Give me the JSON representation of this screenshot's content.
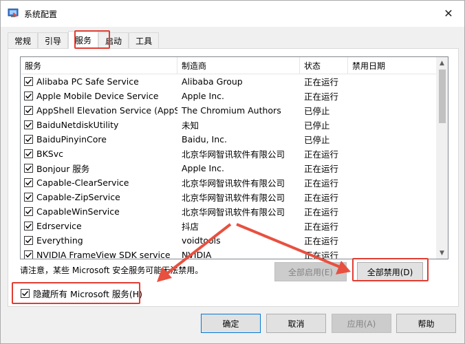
{
  "window": {
    "title": "系统配置",
    "close_glyph": "✕"
  },
  "tabs": [
    {
      "label": "常规"
    },
    {
      "label": "引导"
    },
    {
      "label": "服务"
    },
    {
      "label": "启动"
    },
    {
      "label": "工具"
    }
  ],
  "list": {
    "headers": {
      "service": "服务",
      "maker": "制造商",
      "status": "状态",
      "date": "禁用日期"
    },
    "rows": [
      {
        "service": "Alibaba PC Safe Service",
        "maker": "Alibaba Group",
        "status": "正在运行",
        "date": ""
      },
      {
        "service": "Apple Mobile Device Service",
        "maker": "Apple Inc.",
        "status": "正在运行",
        "date": ""
      },
      {
        "service": "AppShell Elevation Service (AppS...",
        "maker": "The Chromium Authors",
        "status": "已停止",
        "date": ""
      },
      {
        "service": "BaiduNetdiskUtility",
        "maker": "未知",
        "status": "已停止",
        "date": ""
      },
      {
        "service": "BaiduPinyinCore",
        "maker": "Baidu, Inc.",
        "status": "已停止",
        "date": ""
      },
      {
        "service": "BKSvc",
        "maker": "北京华网智讯软件有限公司",
        "status": "正在运行",
        "date": ""
      },
      {
        "service": "Bonjour 服务",
        "maker": "Apple Inc.",
        "status": "正在运行",
        "date": ""
      },
      {
        "service": "Capable-ClearService",
        "maker": "北京华网智讯软件有限公司",
        "status": "正在运行",
        "date": ""
      },
      {
        "service": "Capable-ZipService",
        "maker": "北京华网智讯软件有限公司",
        "status": "正在运行",
        "date": ""
      },
      {
        "service": "CapableWinService",
        "maker": "北京华网智讯软件有限公司",
        "status": "正在运行",
        "date": ""
      },
      {
        "service": "Edrservice",
        "maker": "抖店",
        "status": "正在运行",
        "date": ""
      },
      {
        "service": "Everything",
        "maker": "voidtools",
        "status": "正在运行",
        "date": ""
      },
      {
        "service": "NVIDIA FrameView SDK service",
        "maker": "NVIDIA",
        "status": "正在运行",
        "date": ""
      }
    ]
  },
  "notice": "请注意，某些 Microsoft 安全服务可能无法禁用。",
  "buttons": {
    "enable_all": "全部启用(E)",
    "disable_all": "全部禁用(D)",
    "ok": "确定",
    "cancel": "取消",
    "apply": "应用(A)",
    "help": "帮助"
  },
  "hide_ms": {
    "label": "隐藏所有 Microsoft 服务(H)",
    "checked": true
  },
  "colors": {
    "highlight": "#e03c31",
    "arrow": "#e8503f"
  }
}
